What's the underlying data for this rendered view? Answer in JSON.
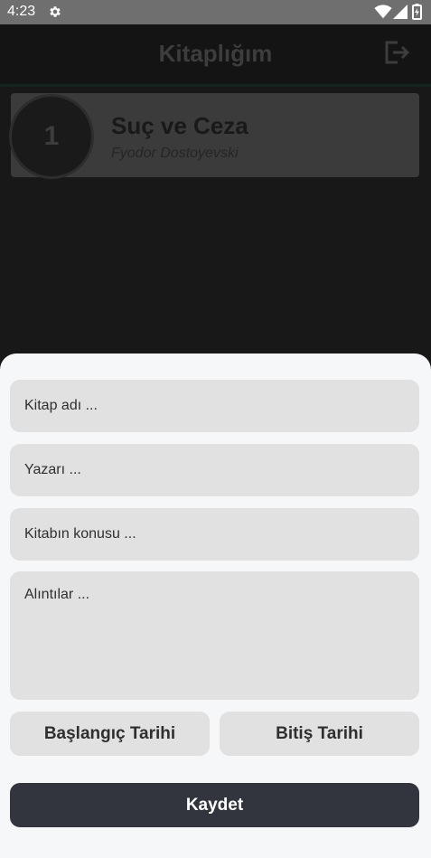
{
  "status_bar": {
    "time": "4:23",
    "icons": [
      "gear-icon",
      "wifi-icon",
      "cell-signal-icon",
      "battery-icon"
    ]
  },
  "app_bar": {
    "title": "Kitaplığım",
    "logout_icon": "logout-icon"
  },
  "books": [
    {
      "number": "1",
      "title": "Suç ve Ceza",
      "author": "Fyodor Dostoyevski"
    }
  ],
  "form": {
    "book_name_placeholder": "Kitap adı ...",
    "author_placeholder": "Yazarı ...",
    "topic_placeholder": "Kitabın konusu ...",
    "quotes_placeholder": "Alıntılar ...",
    "start_date_label": "Başlangıç Tarihi",
    "end_date_label": "Bitiş Tarihi",
    "save_label": "Kaydet"
  },
  "colors": {
    "status_bar_bg": "#6f6f6f",
    "background": "#181818",
    "sheet_bg": "#f6f7f9",
    "field_bg": "#e1e1e1",
    "save_button_bg": "#32353d"
  }
}
